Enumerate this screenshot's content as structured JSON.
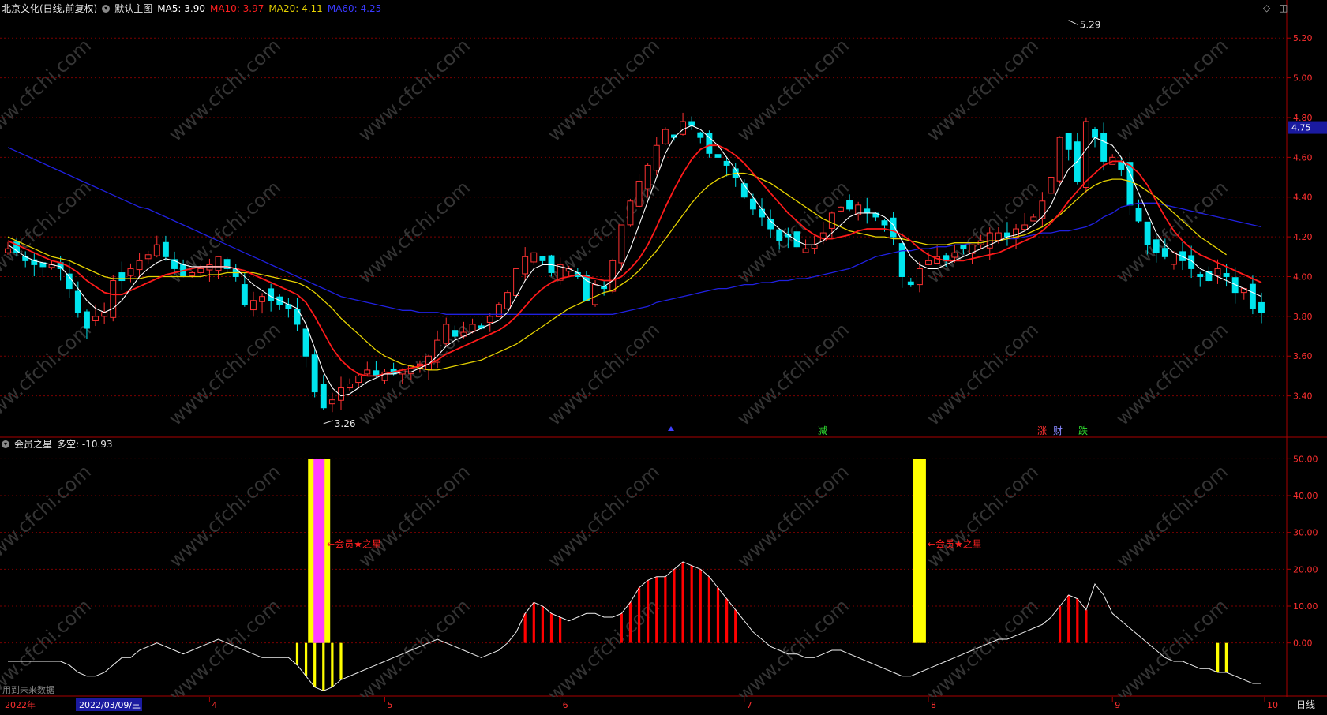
{
  "main_header": {
    "title": "北京文化(日线,前复权)",
    "template": "默认主图",
    "ma5": "MA5: 3.90",
    "ma10": "MA10: 3.97",
    "ma20": "MA20: 4.11",
    "ma60": "MA60: 4.25"
  },
  "sub_header": {
    "title": "会员之星",
    "value": "多空: -10.93"
  },
  "price_axis": {
    "ticks": [
      "5.20",
      "5.00",
      "4.80",
      "4.60",
      "4.40",
      "4.20",
      "4.00",
      "3.80",
      "3.60",
      "3.40"
    ],
    "current": "4.75"
  },
  "ind_axis": {
    "ticks": [
      "50.00",
      "40.00",
      "30.00",
      "20.00",
      "10.00",
      "0.00"
    ]
  },
  "time_axis": {
    "year": "2022年",
    "cursor_date": "2022/03/09/三",
    "months": [
      "4",
      "5",
      "6",
      "7",
      "8",
      "9",
      "10"
    ],
    "period": "日线"
  },
  "annotations": {
    "high": "5.29",
    "low": "3.26",
    "marker_jian": "减",
    "marker_zhang": "涨",
    "marker_cai": "财",
    "marker_die": "跌",
    "signal_label_1": "←会员★之星",
    "signal_label_2": "←会员★之星",
    "footnote": "用到未来数据"
  },
  "watermark": "www.cfchi.com",
  "colors": {
    "up": "#ff3232",
    "down": "#00e5ee",
    "ma5": "#ffffff",
    "ma10": "#ff1a1a",
    "ma20": "#e6d200",
    "ma60": "#2020e0",
    "yellow_bar": "#ffff00",
    "magenta_bar": "#ff40ff",
    "red_bar": "#ff0000",
    "grid": "#7a0000"
  },
  "chart_data": [
    {
      "type": "candlestick",
      "title": "北京文化(日线,前复权)",
      "ylim": [
        3.2,
        5.32
      ],
      "y_ticks": [
        3.4,
        3.6,
        3.8,
        4.0,
        4.2,
        4.4,
        4.6,
        4.8,
        5.0,
        5.2
      ],
      "high_mark": 5.29,
      "low_mark": 3.26,
      "last_close": 3.82,
      "series": [
        {
          "name": "MA5",
          "value": 3.9
        },
        {
          "name": "MA10",
          "value": 3.97
        },
        {
          "name": "MA20",
          "value": 4.11
        },
        {
          "name": "MA60",
          "value": 4.25
        }
      ],
      "closes": [
        4.14,
        4.12,
        4.08,
        4.06,
        4.05,
        4.06,
        4.04,
        3.94,
        3.82,
        3.74,
        3.8,
        3.82,
        3.98,
        3.98,
        4.04,
        4.08,
        4.11,
        4.16,
        4.1,
        4.04,
        4.0,
        4.02,
        4.04,
        4.06,
        4.1,
        4.04,
        4.0,
        3.86,
        3.88,
        3.9,
        3.88,
        3.86,
        3.84,
        3.76,
        3.6,
        3.42,
        3.34,
        3.38,
        3.44,
        3.46,
        3.5,
        3.53,
        3.5,
        3.52,
        3.51,
        3.53,
        3.55,
        3.56,
        3.6,
        3.68,
        3.76,
        3.7,
        3.72,
        3.76,
        3.74,
        3.8,
        3.86,
        3.92,
        4.04,
        4.1,
        4.12,
        4.08,
        4.02,
        4.06,
        4.04,
        4.0,
        3.88,
        3.96,
        3.94,
        4.08,
        4.26,
        4.38,
        4.48,
        4.56,
        4.66,
        4.74,
        4.7,
        4.78,
        4.76,
        4.7,
        4.62,
        4.6,
        4.56,
        4.5,
        4.4,
        4.34,
        4.3,
        4.24,
        4.18,
        4.2,
        4.15,
        4.14,
        4.16,
        4.22,
        4.32,
        4.35,
        4.34,
        4.36,
        4.32,
        4.3,
        4.26,
        4.2,
        4.0,
        3.96,
        4.04,
        4.08,
        4.1,
        4.08,
        4.12,
        4.14,
        4.16,
        4.18,
        4.22,
        4.22,
        4.2,
        4.24,
        4.26,
        4.3,
        4.38,
        4.5,
        4.7,
        4.64,
        4.48,
        4.78,
        4.7,
        4.58,
        4.6,
        4.54,
        4.36,
        4.28,
        4.16,
        4.12,
        4.1,
        4.12,
        4.08,
        4.04,
        4.0,
        3.98,
        4.04,
        4.0,
        3.92,
        3.94,
        3.84,
        3.82
      ],
      "ma5": [
        4.16,
        4.13,
        4.1,
        4.08,
        4.07,
        4.06,
        4.05,
        4.0,
        3.94,
        3.88,
        3.84,
        3.82,
        3.84,
        3.88,
        3.94,
        4.0,
        4.04,
        4.07,
        4.09,
        4.08,
        4.06,
        4.05,
        4.05,
        4.05,
        4.05,
        4.05,
        4.04,
        4.0,
        3.96,
        3.93,
        3.9,
        3.88,
        3.86,
        3.84,
        3.76,
        3.64,
        3.52,
        3.44,
        3.4,
        3.41,
        3.44,
        3.47,
        3.49,
        3.51,
        3.51,
        3.52,
        3.52,
        3.54,
        3.56,
        3.6,
        3.65,
        3.68,
        3.7,
        3.72,
        3.74,
        3.76,
        3.78,
        3.82,
        3.9,
        3.98,
        4.04,
        4.06,
        4.06,
        4.05,
        4.04,
        4.02,
        3.98,
        3.96,
        3.95,
        3.98,
        4.04,
        4.14,
        4.26,
        4.38,
        4.5,
        4.62,
        4.7,
        4.74,
        4.76,
        4.74,
        4.7,
        4.66,
        4.6,
        4.54,
        4.46,
        4.4,
        4.34,
        4.28,
        4.24,
        4.21,
        4.18,
        4.16,
        4.16,
        4.18,
        4.22,
        4.26,
        4.3,
        4.32,
        4.32,
        4.32,
        4.3,
        4.26,
        4.18,
        4.1,
        4.06,
        4.04,
        4.04,
        4.06,
        4.08,
        4.1,
        4.12,
        4.14,
        4.16,
        4.18,
        4.2,
        4.21,
        4.23,
        4.26,
        4.3,
        4.36,
        4.46,
        4.54,
        4.58,
        4.64,
        4.7,
        4.68,
        4.66,
        4.6,
        4.52,
        4.42,
        4.32,
        4.22,
        4.16,
        4.12,
        4.1,
        4.08,
        4.04,
        4.02,
        4.0,
        3.98,
        3.96,
        3.94,
        3.92,
        3.9
      ],
      "ma10": [
        4.18,
        4.16,
        4.14,
        4.12,
        4.1,
        4.08,
        4.07,
        4.05,
        4.02,
        3.98,
        3.95,
        3.92,
        3.91,
        3.91,
        3.93,
        3.95,
        3.97,
        3.99,
        4.01,
        4.02,
        4.03,
        4.04,
        4.05,
        4.05,
        4.05,
        4.05,
        4.04,
        4.03,
        4.01,
        3.99,
        3.97,
        3.95,
        3.93,
        3.91,
        3.87,
        3.8,
        3.72,
        3.64,
        3.58,
        3.54,
        3.51,
        3.5,
        3.5,
        3.51,
        3.52,
        3.53,
        3.54,
        3.55,
        3.56,
        3.58,
        3.61,
        3.63,
        3.65,
        3.67,
        3.69,
        3.71,
        3.73,
        3.76,
        3.8,
        3.85,
        3.9,
        3.94,
        3.97,
        3.99,
        4.0,
        4.01,
        4.0,
        3.99,
        3.98,
        3.98,
        4.0,
        4.04,
        4.09,
        4.16,
        4.25,
        4.35,
        4.44,
        4.52,
        4.59,
        4.64,
        4.66,
        4.66,
        4.64,
        4.61,
        4.57,
        4.52,
        4.47,
        4.42,
        4.37,
        4.32,
        4.28,
        4.24,
        4.21,
        4.19,
        4.19,
        4.2,
        4.21,
        4.23,
        4.24,
        4.24,
        4.24,
        4.23,
        4.21,
        4.18,
        4.14,
        4.11,
        4.09,
        4.08,
        4.08,
        4.08,
        4.09,
        4.1,
        4.11,
        4.12,
        4.14,
        4.16,
        4.18,
        4.2,
        4.23,
        4.27,
        4.32,
        4.38,
        4.43,
        4.48,
        4.52,
        4.56,
        4.58,
        4.58,
        4.56,
        4.52,
        4.46,
        4.38,
        4.3,
        4.23,
        4.18,
        4.14,
        4.11,
        4.09,
        4.07,
        4.05,
        4.03,
        4.01,
        3.99,
        3.97
      ],
      "ma20": [
        4.2,
        4.18,
        4.16,
        4.14,
        4.12,
        4.1,
        4.09,
        4.08,
        4.06,
        4.04,
        4.02,
        4.0,
        3.99,
        3.99,
        3.99,
        3.99,
        4.0,
        4.0,
        4.0,
        4.0,
        4.0,
        4.0,
        4.0,
        4.01,
        4.01,
        4.02,
        4.02,
        4.02,
        4.02,
        4.01,
        4.0,
        3.99,
        3.98,
        3.97,
        3.95,
        3.92,
        3.88,
        3.84,
        3.79,
        3.75,
        3.71,
        3.67,
        3.63,
        3.6,
        3.58,
        3.56,
        3.55,
        3.54,
        3.53,
        3.53,
        3.54,
        3.55,
        3.56,
        3.57,
        3.58,
        3.6,
        3.62,
        3.64,
        3.66,
        3.69,
        3.72,
        3.75,
        3.78,
        3.81,
        3.84,
        3.86,
        3.88,
        3.9,
        3.92,
        3.93,
        3.96,
        3.99,
        4.03,
        4.08,
        4.13,
        4.19,
        4.25,
        4.31,
        4.37,
        4.42,
        4.46,
        4.49,
        4.51,
        4.52,
        4.52,
        4.51,
        4.49,
        4.47,
        4.44,
        4.41,
        4.38,
        4.35,
        4.32,
        4.29,
        4.27,
        4.25,
        4.23,
        4.22,
        4.21,
        4.2,
        4.2,
        4.19,
        4.19,
        4.18,
        4.17,
        4.16,
        4.16,
        4.16,
        4.17,
        4.17,
        4.17,
        4.17,
        4.18,
        4.18,
        4.19,
        4.2,
        4.21,
        4.23,
        4.25,
        4.28,
        4.31,
        4.35,
        4.39,
        4.43,
        4.46,
        4.48,
        4.49,
        4.49,
        4.48,
        4.46,
        4.43,
        4.4,
        4.36,
        4.32,
        4.28,
        4.24,
        4.2,
        4.17,
        4.14,
        4.11
      ],
      "ma60": [
        4.65,
        4.63,
        4.61,
        4.59,
        4.57,
        4.55,
        4.53,
        4.51,
        4.49,
        4.47,
        4.45,
        4.43,
        4.41,
        4.39,
        4.37,
        4.35,
        4.34,
        4.32,
        4.3,
        4.28,
        4.26,
        4.24,
        4.22,
        4.2,
        4.18,
        4.16,
        4.14,
        4.12,
        4.1,
        4.08,
        4.06,
        4.04,
        4.02,
        4.0,
        3.98,
        3.96,
        3.94,
        3.92,
        3.9,
        3.89,
        3.88,
        3.87,
        3.86,
        3.85,
        3.84,
        3.83,
        3.83,
        3.82,
        3.82,
        3.82,
        3.81,
        3.81,
        3.81,
        3.81,
        3.81,
        3.81,
        3.81,
        3.81,
        3.81,
        3.81,
        3.81,
        3.81,
        3.81,
        3.81,
        3.81,
        3.81,
        3.81,
        3.81,
        3.81,
        3.81,
        3.82,
        3.83,
        3.84,
        3.85,
        3.87,
        3.88,
        3.89,
        3.9,
        3.91,
        3.92,
        3.93,
        3.94,
        3.94,
        3.95,
        3.96,
        3.96,
        3.97,
        3.97,
        3.98,
        3.98,
        3.99,
        3.99,
        4.0,
        4.01,
        4.02,
        4.03,
        4.04,
        4.06,
        4.08,
        4.1,
        4.11,
        4.12,
        4.13,
        4.13,
        4.14,
        4.14,
        4.15,
        4.15,
        4.16,
        4.16,
        4.17,
        4.17,
        4.18,
        4.18,
        4.19,
        4.19,
        4.2,
        4.21,
        4.22,
        4.22,
        4.23,
        4.23,
        4.24,
        4.25,
        4.27,
        4.3,
        4.32,
        4.35,
        4.36,
        4.37,
        4.37,
        4.37,
        4.36,
        4.35,
        4.34,
        4.33,
        4.32,
        4.31,
        4.3,
        4.29,
        4.28,
        4.27,
        4.26,
        4.25
      ]
    },
    {
      "type": "bar",
      "title": "会员之星",
      "ylim": [
        -14,
        52
      ],
      "y_ticks": [
        0,
        10,
        20,
        30,
        40,
        50
      ],
      "series": [
        {
          "name": "多空",
          "last": -10.93
        }
      ],
      "line": [
        -5,
        -5,
        -5,
        -5,
        -5,
        -5,
        -5,
        -6,
        -8,
        -9,
        -9,
        -8,
        -6,
        -4,
        -4,
        -2,
        -1,
        0,
        -1,
        -2,
        -3,
        -2,
        -1,
        0,
        1,
        0,
        -1,
        -2,
        -3,
        -4,
        -4,
        -4,
        -4,
        -6,
        -9,
        -12,
        -13,
        -12,
        -10,
        -9,
        -8,
        -7,
        -6,
        -5,
        -4,
        -3,
        -2,
        -1,
        0,
        1,
        0,
        -1,
        -2,
        -3,
        -4,
        -3,
        -2,
        0,
        3,
        8,
        11,
        10,
        8,
        7,
        6,
        7,
        8,
        8,
        7,
        7,
        8,
        11,
        15,
        17,
        18,
        18,
        20,
        22,
        21,
        20,
        18,
        15,
        12,
        9,
        6,
        3,
        1,
        -1,
        -2,
        -3,
        -3,
        -4,
        -4,
        -3,
        -2,
        -2,
        -3,
        -4,
        -5,
        -6,
        -7,
        -8,
        -9,
        -9,
        -8,
        -7,
        -6,
        -5,
        -4,
        -3,
        -2,
        -1,
        0,
        1,
        1,
        2,
        3,
        4,
        5,
        7,
        10,
        13,
        12,
        9,
        16,
        13,
        8,
        6,
        4,
        2,
        0,
        -2,
        -4,
        -5,
        -5,
        -6,
        -7,
        -7,
        -8,
        -8,
        -9,
        -10,
        -11,
        -11
      ],
      "yellow_signal_bars": [
        0.0,
        50.0
      ],
      "magenta_signal_bar": [
        0.0,
        50.0
      ]
    }
  ]
}
